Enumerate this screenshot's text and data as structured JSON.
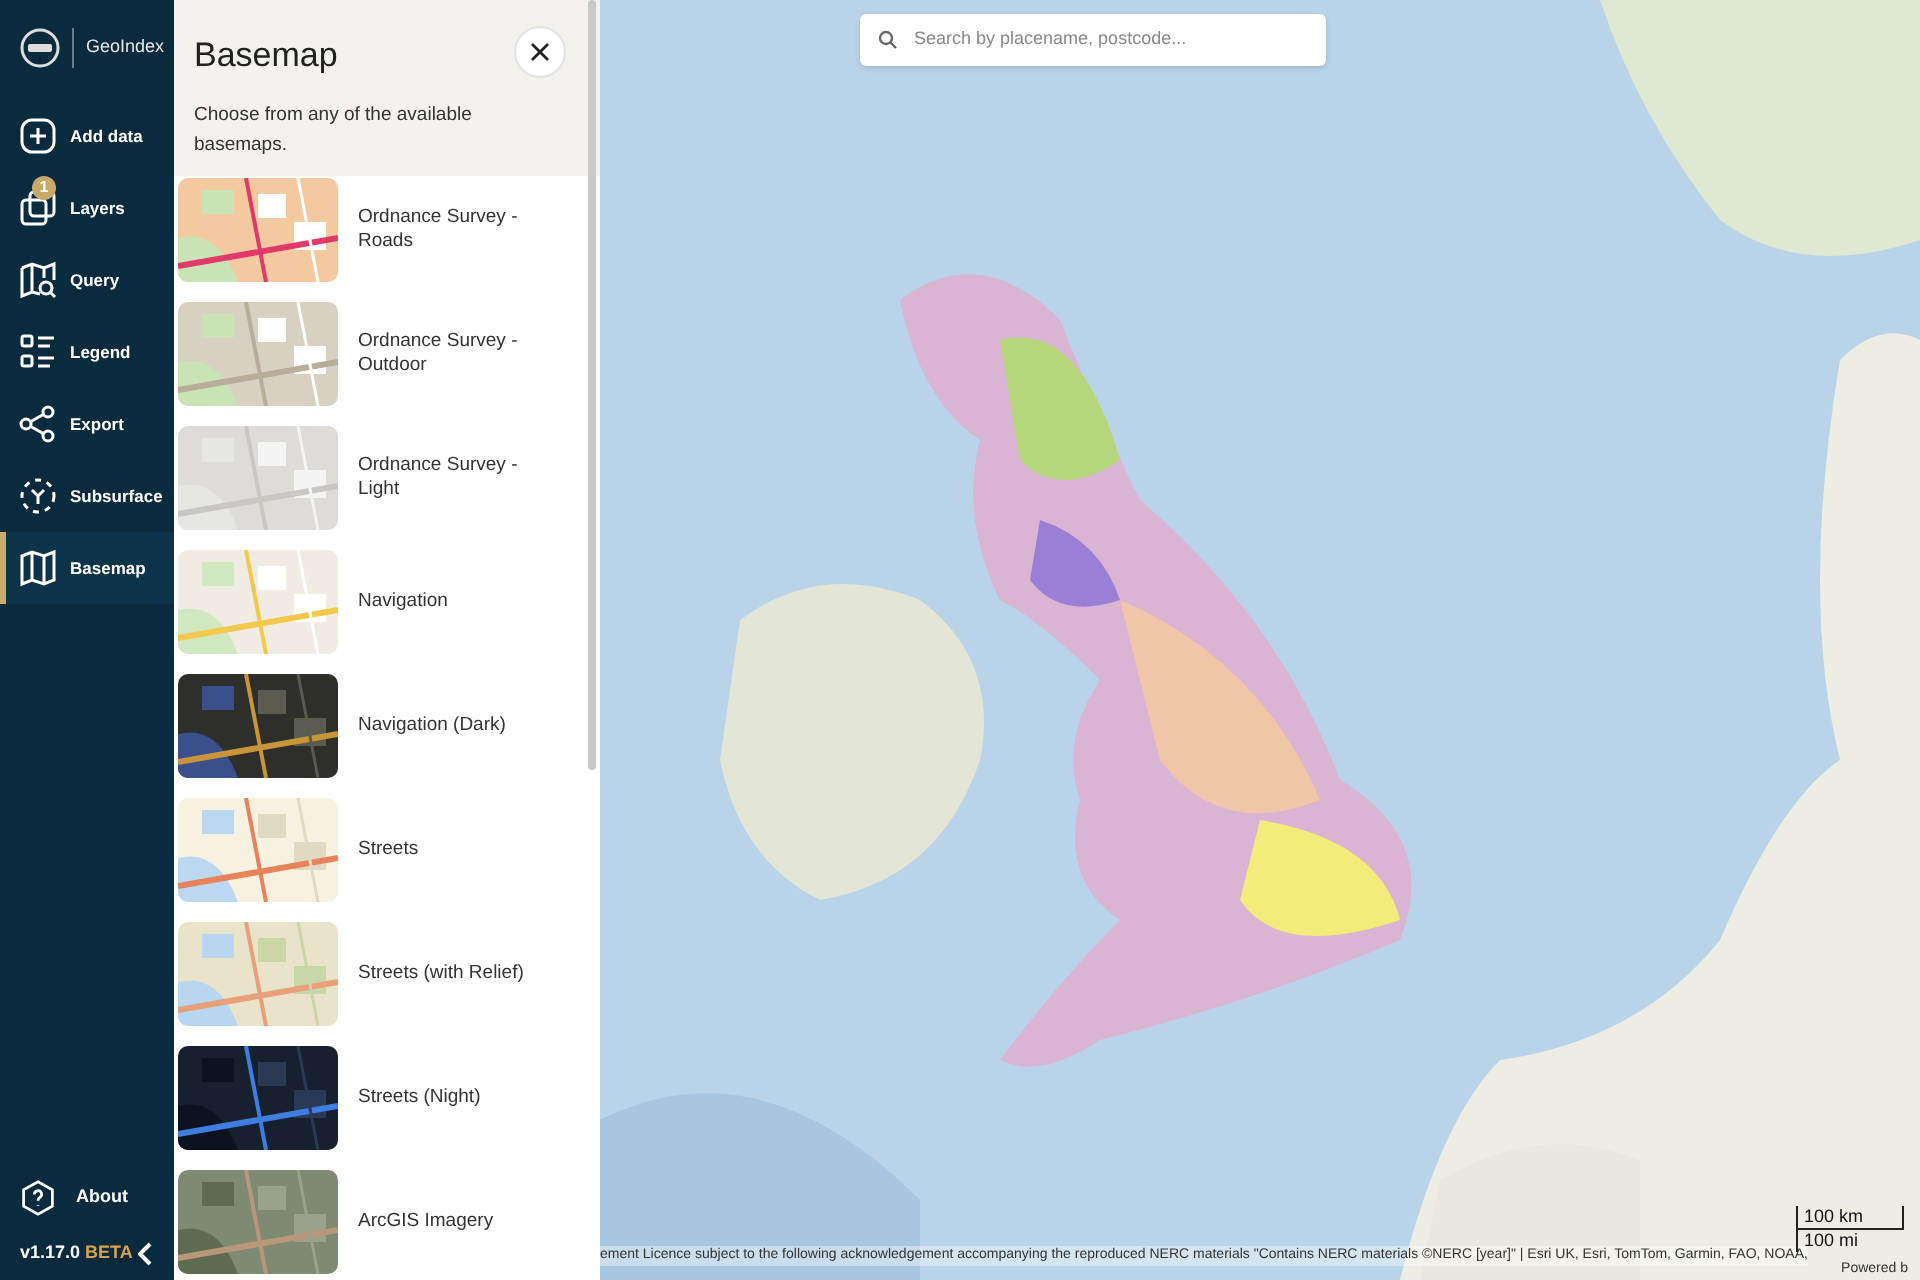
{
  "app": {
    "name": "GeoIndex",
    "version": "v1.17.0",
    "channel": "BETA"
  },
  "nav": [
    {
      "label": "Add data",
      "kind": "plus",
      "selected": false
    },
    {
      "label": "Layers",
      "kind": "layers",
      "selected": false,
      "badge": "1"
    },
    {
      "label": "Query",
      "kind": "query",
      "selected": false
    },
    {
      "label": "Legend",
      "kind": "legend",
      "selected": false
    },
    {
      "label": "Export",
      "kind": "share",
      "selected": false
    },
    {
      "label": "Subsurface",
      "kind": "subsurface",
      "selected": false
    },
    {
      "label": "Basemap",
      "kind": "map",
      "selected": true
    }
  ],
  "about": {
    "label": "About"
  },
  "panel": {
    "title": "Basemap",
    "description": "Choose from any of the available basemaps.",
    "basemaps": [
      {
        "label": "Ordnance Survey - Roads",
        "kind": "roads"
      },
      {
        "label": "Ordnance Survey - Outdoor",
        "kind": "outdoor"
      },
      {
        "label": "Ordnance Survey - Light",
        "kind": "light"
      },
      {
        "label": "Navigation",
        "kind": "navigation"
      },
      {
        "label": "Navigation (Dark)",
        "kind": "dark"
      },
      {
        "label": "Streets",
        "kind": "streets"
      },
      {
        "label": "Streets (with Relief)",
        "kind": "relief"
      },
      {
        "label": "Streets (Night)",
        "kind": "night"
      },
      {
        "label": "ArcGIS Imagery",
        "kind": "imagery"
      }
    ]
  },
  "map": {
    "search": {
      "placeholder": "Search by placename, postcode..."
    },
    "attribution": "ement Licence subject to the following acknowledgement accompanying the reproduced NERC materials \"Contains NERC materials ©NERC [year]\" | Esri UK, Esri, TomTom, Garmin, FAO, NOAA,",
    "powered_by": "Powered b",
    "scale": [
      "100 km",
      "100 mi"
    ]
  }
}
